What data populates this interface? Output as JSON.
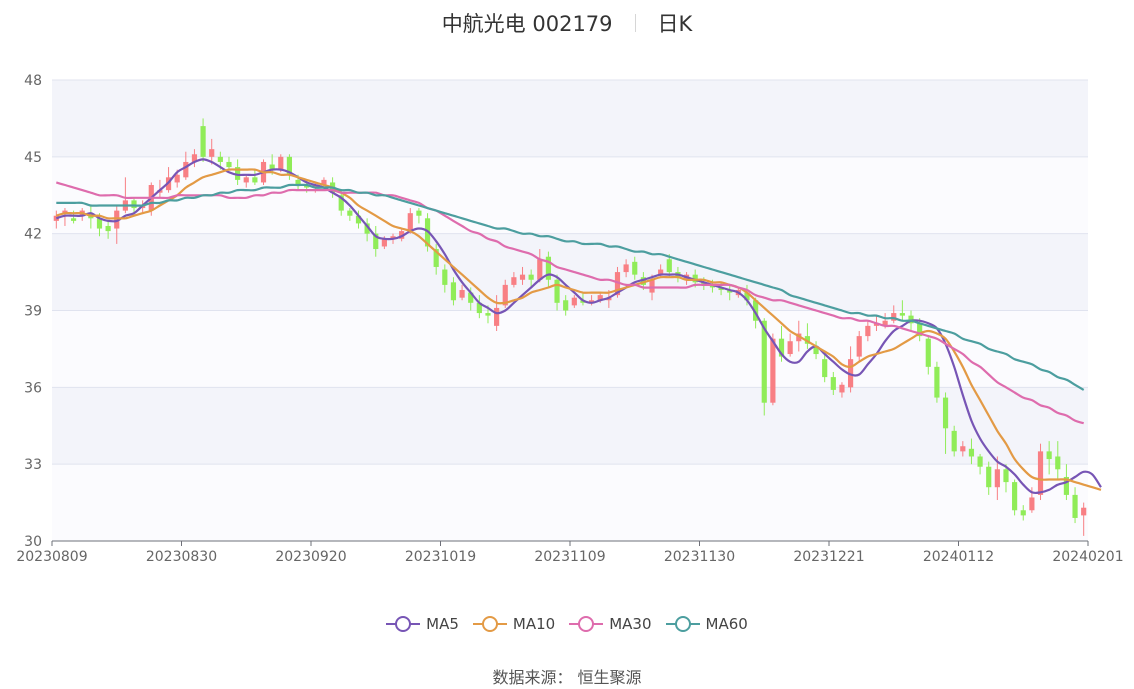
{
  "header": {
    "title": "中航光电 002179",
    "period": "日K"
  },
  "source": "数据来源： 恒生聚源",
  "chart_data": {
    "type": "candlestick",
    "ylim": [
      30,
      48
    ],
    "yticks": [
      "30",
      "33",
      "36",
      "39",
      "42",
      "45",
      "48"
    ],
    "xticks": [
      "20230809",
      "20230830",
      "20230920",
      "20231019",
      "20231109",
      "20231130",
      "20231221",
      "20240112",
      "20240201"
    ],
    "colors": {
      "up": "#f87f84",
      "down": "#90ec58",
      "ma5": "#7755b5",
      "ma10": "#e39a45",
      "ma30": "#de6cad",
      "ma60": "#4c9e9f"
    },
    "candles": [
      [
        42.5,
        42.9,
        42.7,
        42.2
      ],
      [
        42.8,
        43.0,
        42.9,
        42.3
      ],
      [
        42.6,
        42.9,
        42.5,
        42.4
      ],
      [
        42.7,
        43.0,
        42.9,
        42.5
      ],
      [
        42.8,
        43.1,
        42.6,
        42.2
      ],
      [
        42.6,
        42.8,
        42.2,
        41.9
      ],
      [
        42.3,
        42.5,
        42.1,
        41.8
      ],
      [
        42.2,
        43.1,
        42.9,
        41.6
      ],
      [
        42.9,
        44.2,
        43.3,
        42.8
      ],
      [
        43.3,
        43.4,
        43.0,
        42.7
      ],
      [
        43.0,
        43.3,
        43.1,
        42.8
      ],
      [
        42.9,
        44.0,
        43.9,
        42.7
      ],
      [
        43.6,
        44.1,
        43.7,
        43.4
      ],
      [
        43.7,
        44.6,
        44.2,
        43.6
      ],
      [
        44.0,
        44.5,
        44.3,
        43.8
      ],
      [
        44.2,
        45.2,
        44.8,
        44.1
      ],
      [
        44.8,
        45.3,
        45.1,
        44.6
      ],
      [
        46.2,
        46.5,
        45.0,
        44.8
      ],
      [
        45.0,
        45.7,
        45.3,
        44.7
      ],
      [
        45.0,
        45.2,
        44.8,
        44.5
      ],
      [
        44.8,
        45.0,
        44.6,
        44.5
      ],
      [
        44.6,
        44.9,
        44.1,
        43.9
      ],
      [
        44.0,
        44.3,
        44.2,
        43.8
      ],
      [
        44.2,
        44.5,
        44.0,
        43.9
      ],
      [
        44.0,
        44.9,
        44.8,
        43.9
      ],
      [
        44.7,
        45.1,
        44.5,
        44.3
      ],
      [
        44.5,
        45.1,
        45.0,
        44.4
      ],
      [
        45.0,
        45.1,
        44.3,
        44.1
      ],
      [
        44.1,
        44.3,
        43.9,
        43.7
      ],
      [
        43.9,
        44.1,
        43.8,
        43.6
      ],
      [
        43.8,
        44.0,
        43.9,
        43.6
      ],
      [
        43.9,
        44.2,
        44.1,
        43.7
      ],
      [
        44.0,
        44.2,
        43.6,
        43.4
      ],
      [
        43.5,
        43.7,
        42.9,
        42.7
      ],
      [
        42.9,
        43.0,
        42.7,
        42.5
      ],
      [
        42.7,
        42.9,
        42.4,
        42.2
      ],
      [
        42.4,
        42.6,
        42.0,
        41.7
      ],
      [
        42.0,
        42.3,
        41.4,
        41.1
      ],
      [
        41.5,
        41.9,
        41.8,
        41.4
      ],
      [
        41.8,
        42.0,
        41.9,
        41.6
      ],
      [
        41.8,
        42.2,
        42.1,
        41.7
      ],
      [
        42.1,
        43.0,
        42.8,
        42.0
      ],
      [
        42.9,
        43.0,
        42.7,
        42.4
      ],
      [
        42.6,
        42.8,
        41.5,
        41.3
      ],
      [
        41.4,
        41.6,
        40.7,
        40.4
      ],
      [
        40.6,
        40.8,
        40.0,
        39.7
      ],
      [
        40.1,
        40.3,
        39.4,
        39.2
      ],
      [
        39.5,
        40.0,
        39.8,
        39.4
      ],
      [
        39.7,
        39.9,
        39.3,
        39.0
      ],
      [
        39.3,
        39.6,
        38.9,
        38.7
      ],
      [
        38.9,
        39.2,
        38.8,
        38.5
      ],
      [
        38.4,
        39.6,
        39.1,
        38.2
      ],
      [
        39.2,
        40.2,
        40.0,
        39.1
      ],
      [
        40.0,
        40.5,
        40.3,
        39.9
      ],
      [
        40.2,
        40.7,
        40.4,
        40.0
      ],
      [
        40.4,
        40.6,
        40.2,
        39.9
      ],
      [
        40.2,
        41.4,
        41.0,
        40.1
      ],
      [
        41.1,
        41.3,
        40.2,
        39.9
      ],
      [
        40.2,
        40.4,
        39.3,
        39.0
      ],
      [
        39.4,
        39.6,
        39.0,
        38.8
      ],
      [
        39.2,
        39.6,
        39.5,
        39.1
      ],
      [
        39.4,
        39.7,
        39.3,
        39.2
      ],
      [
        39.3,
        39.6,
        39.4,
        39.2
      ],
      [
        39.4,
        39.7,
        39.6,
        39.3
      ],
      [
        39.4,
        39.8,
        39.5,
        39.1
      ],
      [
        39.6,
        40.7,
        40.5,
        39.5
      ],
      [
        40.5,
        41.0,
        40.8,
        40.3
      ],
      [
        40.9,
        41.1,
        40.4,
        40.2
      ],
      [
        40.3,
        40.5,
        40.0,
        39.8
      ],
      [
        39.7,
        40.4,
        40.2,
        39.4
      ],
      [
        40.4,
        40.8,
        40.6,
        40.3
      ],
      [
        41.0,
        41.2,
        40.5,
        40.3
      ],
      [
        40.5,
        40.7,
        40.3,
        40.1
      ],
      [
        40.2,
        40.5,
        40.4,
        40.0
      ],
      [
        40.4,
        40.6,
        40.1,
        39.9
      ],
      [
        40.1,
        40.3,
        40.0,
        39.8
      ],
      [
        40.0,
        40.2,
        39.9,
        39.7
      ],
      [
        39.9,
        40.1,
        39.8,
        39.6
      ],
      [
        39.8,
        40.0,
        39.7,
        39.4
      ],
      [
        39.6,
        39.9,
        39.8,
        39.5
      ],
      [
        39.7,
        40.0,
        39.4,
        39.2
      ],
      [
        39.4,
        39.5,
        38.6,
        38.3
      ],
      [
        38.6,
        38.7,
        35.4,
        34.9
      ],
      [
        35.4,
        38.1,
        37.9,
        35.3
      ],
      [
        37.9,
        38.4,
        37.2,
        37.0
      ],
      [
        37.3,
        38.1,
        37.8,
        37.2
      ],
      [
        37.8,
        38.6,
        38.1,
        37.4
      ],
      [
        38.0,
        38.5,
        37.7,
        37.5
      ],
      [
        37.6,
        37.8,
        37.3,
        37.1
      ],
      [
        37.1,
        37.3,
        36.4,
        36.2
      ],
      [
        36.4,
        36.6,
        35.9,
        35.7
      ],
      [
        35.8,
        36.2,
        36.1,
        35.6
      ],
      [
        36.0,
        37.6,
        37.1,
        35.8
      ],
      [
        37.2,
        38.2,
        38.0,
        37.0
      ],
      [
        38.0,
        38.6,
        38.4,
        37.8
      ],
      [
        38.4,
        38.8,
        38.5,
        38.2
      ],
      [
        38.4,
        38.9,
        38.6,
        38.3
      ],
      [
        38.6,
        39.2,
        38.9,
        38.5
      ],
      [
        38.9,
        39.4,
        38.8,
        38.6
      ],
      [
        38.8,
        39.0,
        38.5,
        38.2
      ],
      [
        38.5,
        38.7,
        38.0,
        37.8
      ],
      [
        37.9,
        38.0,
        36.8,
        36.5
      ],
      [
        36.8,
        37.0,
        35.6,
        35.4
      ],
      [
        35.6,
        35.8,
        34.4,
        33.4
      ],
      [
        34.3,
        34.5,
        33.5,
        33.3
      ],
      [
        33.5,
        33.9,
        33.7,
        33.3
      ],
      [
        33.6,
        34.0,
        33.3,
        33.0
      ],
      [
        33.3,
        33.4,
        32.9,
        32.6
      ],
      [
        32.9,
        33.1,
        32.1,
        31.8
      ],
      [
        32.1,
        33.3,
        32.8,
        31.6
      ],
      [
        32.8,
        33.0,
        32.3,
        31.9
      ],
      [
        32.3,
        32.4,
        31.2,
        31.0
      ],
      [
        31.2,
        31.4,
        31.0,
        30.8
      ],
      [
        31.2,
        32.1,
        31.7,
        31.1
      ],
      [
        31.8,
        33.8,
        33.5,
        31.6
      ],
      [
        33.5,
        33.9,
        33.2,
        32.6
      ],
      [
        33.3,
        33.9,
        32.8,
        32.4
      ],
      [
        32.5,
        33.0,
        31.8,
        31.6
      ],
      [
        31.8,
        32.1,
        30.9,
        30.7
      ],
      [
        31.0,
        31.5,
        31.3,
        30.2
      ]
    ],
    "series": [
      {
        "name": "MA5",
        "values": [
          42.6,
          42.7,
          42.7,
          42.7,
          42.8,
          42.6,
          42.5,
          42.5,
          42.7,
          42.8,
          43.1,
          43.4,
          43.7,
          44.0,
          44.4,
          44.6,
          44.8,
          44.9,
          44.8,
          44.6,
          44.4,
          44.3,
          44.3,
          44.3,
          44.4,
          44.5,
          44.5,
          44.4,
          44.2,
          44.0,
          43.9,
          43.8,
          43.6,
          43.4,
          43.1,
          42.7,
          42.3,
          41.9,
          41.8,
          41.8,
          41.9,
          42.1,
          42.2,
          42.1,
          41.7,
          41.2,
          40.6,
          40.1,
          39.7,
          39.3,
          39.1,
          38.9,
          39.0,
          39.3,
          39.6,
          39.9,
          40.2,
          40.4,
          40.3,
          40.0,
          39.7,
          39.4,
          39.3,
          39.4,
          39.5,
          39.7,
          39.9,
          40.1,
          40.2,
          40.3,
          40.4,
          40.4,
          40.4,
          40.3,
          40.2,
          40.1,
          40.0,
          39.9,
          39.8,
          39.7,
          39.4,
          38.9,
          38.3,
          37.8,
          37.3,
          37.0,
          37.0,
          37.4,
          37.6,
          37.3,
          37.0,
          36.7,
          36.5,
          36.5,
          36.9,
          37.3,
          37.8,
          38.2,
          38.4,
          38.6,
          38.6,
          38.5,
          38.3,
          37.7,
          36.8,
          35.7,
          34.7,
          34.0,
          33.5,
          33.1,
          32.9,
          32.6,
          32.2,
          31.9,
          31.9,
          32.0,
          32.2,
          32.3,
          32.5,
          32.7,
          32.6,
          32.1
        ]
      },
      {
        "name": "MA10",
        "values": [
          42.7,
          42.8,
          42.8,
          42.8,
          42.7,
          42.7,
          42.6,
          42.6,
          42.6,
          42.7,
          42.8,
          42.9,
          43.1,
          43.3,
          43.5,
          43.8,
          44.0,
          44.2,
          44.3,
          44.4,
          44.5,
          44.5,
          44.5,
          44.5,
          44.4,
          44.4,
          44.3,
          44.3,
          44.2,
          44.1,
          44.0,
          43.9,
          43.8,
          43.6,
          43.4,
          43.1,
          42.9,
          42.7,
          42.5,
          42.3,
          42.2,
          42.1,
          41.9,
          41.6,
          41.3,
          41.0,
          40.7,
          40.4,
          40.1,
          39.8,
          39.5,
          39.3,
          39.3,
          39.4,
          39.5,
          39.7,
          39.8,
          39.9,
          40.0,
          39.9,
          39.8,
          39.7,
          39.7,
          39.7,
          39.7,
          39.8,
          39.9,
          40.0,
          40.1,
          40.2,
          40.3,
          40.3,
          40.3,
          40.2,
          40.2,
          40.2,
          40.1,
          40.1,
          40.0,
          39.9,
          39.7,
          39.4,
          39.1,
          38.8,
          38.5,
          38.2,
          38.0,
          37.8,
          37.6,
          37.4,
          37.2,
          36.9,
          36.8,
          37.0,
          37.2,
          37.3,
          37.4,
          37.5,
          37.7,
          37.9,
          38.1,
          38.2,
          38.1,
          37.9,
          37.4,
          36.8,
          36.1,
          35.5,
          34.9,
          34.3,
          33.8,
          33.2,
          32.8,
          32.5,
          32.4,
          32.4,
          32.4,
          32.4,
          32.3,
          32.2,
          32.1,
          32.0
        ]
      },
      {
        "name": "MA30",
        "values": [
          44.0,
          43.9,
          43.8,
          43.7,
          43.6,
          43.5,
          43.5,
          43.5,
          43.4,
          43.4,
          43.4,
          43.4,
          43.4,
          43.4,
          43.5,
          43.5,
          43.5,
          43.5,
          43.5,
          43.5,
          43.4,
          43.4,
          43.4,
          43.5,
          43.5,
          43.6,
          43.6,
          43.7,
          43.7,
          43.7,
          43.7,
          43.7,
          43.7,
          43.6,
          43.6,
          43.6,
          43.6,
          43.6,
          43.5,
          43.5,
          43.4,
          43.3,
          43.2,
          43.0,
          42.9,
          42.7,
          42.5,
          42.3,
          42.1,
          42.0,
          41.8,
          41.7,
          41.5,
          41.4,
          41.3,
          41.2,
          41.0,
          40.9,
          40.7,
          40.6,
          40.5,
          40.4,
          40.3,
          40.2,
          40.2,
          40.1,
          40.0,
          40.0,
          39.9,
          39.9,
          39.9,
          39.9,
          39.9,
          39.9,
          40.0,
          40.0,
          40.0,
          40.0,
          40.0,
          39.9,
          39.8,
          39.6,
          39.5,
          39.4,
          39.4,
          39.3,
          39.2,
          39.1,
          39.0,
          38.9,
          38.8,
          38.7,
          38.7,
          38.6,
          38.6,
          38.5,
          38.4,
          38.4,
          38.3,
          38.2,
          38.1,
          38.0,
          37.9,
          37.7,
          37.5,
          37.3,
          37.0,
          36.8,
          36.5,
          36.2,
          36.0,
          35.8,
          35.6,
          35.5,
          35.3,
          35.2,
          35.0,
          34.9,
          34.7,
          34.6
        ]
      },
      {
        "name": "MA60",
        "values": [
          43.2,
          43.2,
          43.2,
          43.2,
          43.1,
          43.1,
          43.1,
          43.1,
          43.1,
          43.1,
          43.1,
          43.2,
          43.2,
          43.3,
          43.3,
          43.4,
          43.4,
          43.5,
          43.5,
          43.6,
          43.6,
          43.7,
          43.7,
          43.7,
          43.8,
          43.8,
          43.8,
          43.9,
          43.9,
          43.9,
          43.8,
          43.8,
          43.8,
          43.7,
          43.7,
          43.6,
          43.6,
          43.5,
          43.5,
          43.4,
          43.3,
          43.2,
          43.1,
          43.0,
          42.9,
          42.8,
          42.7,
          42.6,
          42.5,
          42.4,
          42.3,
          42.2,
          42.2,
          42.1,
          42.0,
          42.0,
          41.9,
          41.9,
          41.8,
          41.7,
          41.7,
          41.6,
          41.6,
          41.6,
          41.5,
          41.5,
          41.4,
          41.3,
          41.3,
          41.2,
          41.2,
          41.1,
          41.0,
          40.9,
          40.8,
          40.7,
          40.6,
          40.5,
          40.4,
          40.3,
          40.2,
          40.1,
          40.0,
          39.9,
          39.8,
          39.6,
          39.5,
          39.4,
          39.3,
          39.2,
          39.1,
          39.0,
          38.9,
          38.9,
          38.8,
          38.8,
          38.7,
          38.7,
          38.6,
          38.6,
          38.5,
          38.4,
          38.3,
          38.2,
          38.1,
          37.9,
          37.8,
          37.7,
          37.5,
          37.4,
          37.3,
          37.1,
          37.0,
          36.9,
          36.7,
          36.6,
          36.4,
          36.3,
          36.1,
          35.9
        ]
      }
    ]
  }
}
